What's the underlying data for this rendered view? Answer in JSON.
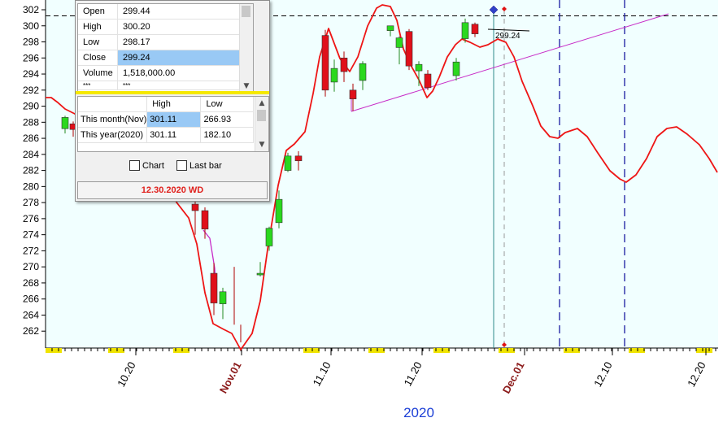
{
  "chart_data": {
    "type": "candlestick",
    "year_label": "2020",
    "y_ticks": [
      262,
      264,
      266,
      268,
      270,
      272,
      274,
      276,
      278,
      280,
      282,
      284,
      286,
      288,
      290,
      292,
      294,
      296,
      298,
      300,
      302
    ],
    "ylim": [
      260.5,
      302.5
    ],
    "x_ticks": [
      {
        "label": "10.20",
        "highlight": false
      },
      {
        "label": "Nov.01",
        "highlight": true
      },
      {
        "label": "11.10",
        "highlight": false
      },
      {
        "label": "11.20",
        "highlight": false
      },
      {
        "label": "Dec.01",
        "highlight": true
      },
      {
        "label": "12.10",
        "highlight": false
      },
      {
        "label": "12.20",
        "highlight": false
      }
    ],
    "candles": [
      {
        "open": 287.2,
        "high": 288.8,
        "low": 286.6,
        "close": 288.6
      },
      {
        "open": 287.8,
        "high": 288.1,
        "low": 286.2,
        "close": 287.1
      },
      {
        "open": 277.8,
        "high": 279.0,
        "low": 274.0,
        "close": 277.0
      },
      {
        "open": 277.0,
        "high": 277.4,
        "low": 273.5,
        "close": 274.7
      },
      {
        "open": 269.2,
        "high": 270.5,
        "low": 264.0,
        "close": 265.5
      },
      {
        "open": 265.4,
        "high": 267.4,
        "low": 263.5,
        "close": 266.9
      },
      {
        "open": 269.0,
        "high": 270.6,
        "low": 268.8,
        "close": 269.2
      },
      {
        "open": 272.6,
        "high": 275.0,
        "low": 272.0,
        "close": 274.8
      },
      {
        "open": 275.5,
        "high": 279.5,
        "low": 274.8,
        "close": 278.4
      },
      {
        "open": 282.0,
        "high": 284.2,
        "low": 281.8,
        "close": 283.8
      },
      {
        "open": 283.8,
        "high": 284.4,
        "low": 282.0,
        "close": 283.2
      },
      {
        "open": 298.8,
        "high": 299.5,
        "low": 291.2,
        "close": 292.0
      },
      {
        "open": 293.0,
        "high": 295.8,
        "low": 291.8,
        "close": 294.7
      },
      {
        "open": 296.0,
        "high": 296.8,
        "low": 293.0,
        "close": 294.3
      },
      {
        "open": 292.0,
        "high": 292.8,
        "low": 289.4,
        "close": 290.9
      },
      {
        "open": 293.2,
        "high": 295.6,
        "low": 292.0,
        "close": 295.3
      },
      {
        "open": 299.4,
        "high": 300.0,
        "low": 298.7,
        "close": 300.0
      },
      {
        "open": 297.3,
        "high": 298.7,
        "low": 295.2,
        "close": 298.5
      },
      {
        "open": 299.3,
        "high": 299.6,
        "low": 294.5,
        "close": 295.0
      },
      {
        "open": 294.4,
        "high": 295.6,
        "low": 292.5,
        "close": 295.2
      },
      {
        "open": 294.0,
        "high": 294.5,
        "low": 292.0,
        "close": 292.3
      },
      {
        "open": 293.8,
        "high": 296.0,
        "low": 293.2,
        "close": 295.5
      },
      {
        "open": 298.4,
        "high": 300.9,
        "low": 297.9,
        "close": 300.4
      },
      {
        "open": 300.2,
        "high": 300.4,
        "low": 298.6,
        "close": 299.0
      }
    ],
    "extra_wicks": [
      {
        "high": 270.0,
        "low": 262.8
      },
      {
        "high": 262.8,
        "low": 260.6
      }
    ],
    "red_curve": [
      [
        56,
        120
      ],
      [
        63,
        120
      ],
      [
        71,
        126
      ],
      [
        80,
        134
      ],
      [
        92,
        140
      ],
      [
        110,
        155
      ],
      [
        125,
        170
      ],
      [
        140,
        185
      ],
      [
        160,
        198
      ],
      [
        175,
        205
      ],
      [
        190,
        212
      ],
      [
        205,
        230
      ],
      [
        218,
        250
      ],
      [
        232,
        268
      ],
      [
        242,
        300
      ],
      [
        252,
        360
      ],
      [
        262,
        398
      ],
      [
        275,
        405
      ],
      [
        285,
        410
      ],
      [
        296,
        430
      ],
      [
        310,
        410
      ],
      [
        320,
        370
      ],
      [
        330,
        300
      ],
      [
        342,
        228
      ],
      [
        352,
        185
      ],
      [
        362,
        177
      ],
      [
        375,
        162
      ],
      [
        385,
        115
      ],
      [
        393,
        70
      ],
      [
        404,
        35
      ],
      [
        418,
        72
      ],
      [
        430,
        88
      ],
      [
        440,
        70
      ],
      [
        452,
        32
      ],
      [
        463,
        10
      ],
      [
        470,
        6
      ],
      [
        480,
        8
      ],
      [
        488,
        25
      ],
      [
        496,
        60
      ],
      [
        505,
        80
      ],
      [
        515,
        98
      ],
      [
        525,
        120
      ],
      [
        532,
        112
      ],
      [
        540,
        95
      ],
      [
        550,
        70
      ],
      [
        560,
        55
      ],
      [
        568,
        48
      ],
      [
        578,
        52
      ],
      [
        590,
        58
      ],
      [
        600,
        55
      ],
      [
        612,
        48
      ],
      [
        622,
        52
      ],
      [
        632,
        70
      ],
      [
        642,
        100
      ],
      [
        655,
        130
      ],
      [
        665,
        155
      ],
      [
        676,
        168
      ],
      [
        686,
        170
      ],
      [
        695,
        163
      ],
      [
        710,
        158
      ],
      [
        722,
        168
      ],
      [
        735,
        188
      ],
      [
        750,
        210
      ],
      [
        762,
        220
      ],
      [
        770,
        224
      ],
      [
        782,
        215
      ],
      [
        795,
        195
      ],
      [
        808,
        168
      ],
      [
        820,
        158
      ],
      [
        832,
        156
      ],
      [
        845,
        165
      ],
      [
        860,
        178
      ],
      [
        872,
        195
      ],
      [
        882,
        212
      ]
    ],
    "purple_curve": [
      [
        250,
        283
      ],
      [
        258,
        293
      ],
      [
        264,
        330
      ],
      [
        266,
        370
      ]
    ],
    "channel_line": {
      "start": [
        432,
        137
      ],
      "end": [
        822,
        17
      ]
    },
    "last_price_label": "299.24",
    "colors": {
      "up": "#2ad81e",
      "down": "#e0101a",
      "curve": "#ee1515",
      "channel": "#c72bc7",
      "plot_bg": "#f1ffff",
      "v_line": "#1a1aa0",
      "cursor": "#2e8b8b"
    }
  },
  "info_panel": {
    "rows": [
      {
        "label": "Open",
        "value": "299.44"
      },
      {
        "label": "High",
        "value": "300.20"
      },
      {
        "label": "Low",
        "value": "298.17"
      },
      {
        "label": "Close",
        "value": "299.24"
      },
      {
        "label": "Volume",
        "value": "1,518,000.00"
      },
      {
        "label": "***",
        "value": "***"
      }
    ],
    "range_header": {
      "blank": "",
      "high": "High",
      "low": "Low"
    },
    "range_rows": [
      {
        "label": "This month(Nov)",
        "high": "301.11",
        "low": "266.93"
      },
      {
        "label": "This year(2020)",
        "high": "301.11",
        "low": "182.10"
      }
    ],
    "chart_checkbox": "Chart",
    "last_bar_checkbox": "Last bar",
    "status": "12.30.2020 WD"
  }
}
